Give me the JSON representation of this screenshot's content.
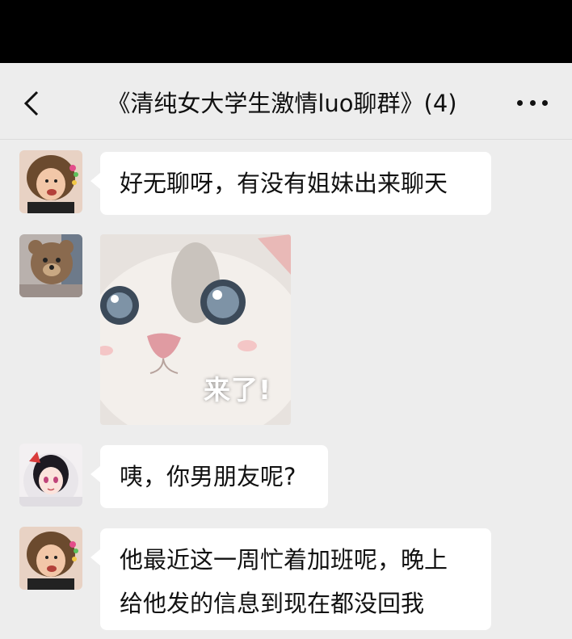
{
  "header": {
    "title": "《清纯女大学生激情luo聊群》(4)"
  },
  "messages": [
    {
      "type": "text",
      "avatar": "curly-toddler-avatar",
      "text": "好无聊呀，有没有姐妹出来聊天"
    },
    {
      "type": "sticker",
      "avatar": "teddy-bear-avatar",
      "sticker": "kitten-sticker",
      "caption": "来了!"
    },
    {
      "type": "text",
      "avatar": "anime-girl-avatar",
      "text": "咦，你男朋友呢?"
    },
    {
      "type": "text",
      "avatar": "curly-toddler-avatar",
      "lines": [
        "他最近这一周忙着加班呢，晚上",
        "给他发的信息到现在都没回我"
      ]
    }
  ],
  "colors": {
    "background": "#ededed",
    "bubble": "#ffffff",
    "status_bar": "#000000"
  }
}
